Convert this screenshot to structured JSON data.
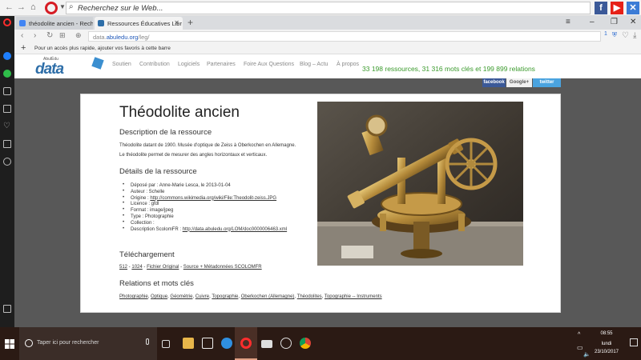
{
  "browser": {
    "search_placeholder": "Recherchez sur le Web...",
    "tabs": [
      {
        "label": "théodolite ancien - Rechr",
        "icon": "google-icon"
      },
      {
        "label": "Ressources Éducatives Libr",
        "icon": "data-abuledu-icon"
      }
    ],
    "url_prefix": "data.",
    "url_domain": "abuledu.org",
    "url_path": "/leg/",
    "badge_count": "1",
    "bookmark_hint": "Pour un accès plus rapide, ajouter vos favoris à cette barre"
  },
  "site": {
    "logo_text": "data",
    "logo_small": "AbulÉdu",
    "menu": [
      "Soutien",
      "Contribution",
      "Logiciels",
      "Partenaires",
      "Foire Aux Questions",
      "Blog – Actu",
      "À propos"
    ],
    "stats": "33 198 ressources, 31 316 mots clés et 199 899 relations",
    "social": [
      "facebook",
      "Google+",
      "twitter"
    ]
  },
  "resource": {
    "title": "Théodolite ancien",
    "desc_heading": "Description de la ressource",
    "desc_line1": "Théodolite datant de 1900. Musée d'optique de Zeiss à Oberkochen en Allemagne.",
    "desc_line2": "Le théodolite permet de mesurer des angles horizontaux et verticaux.",
    "details_heading": "Détails de la ressource",
    "details": {
      "depose": "Déposé par : Anne-Marie Lesca, le 2013-01-04",
      "auteur": "Auteur : Schelle",
      "origine_label": "Origine : ",
      "origine_link": "http://commons.wikimedia.org/wiki/File:Theodolit-zeiss.JPG",
      "licence": "Licence : gfdl",
      "format": "Format : image/jpeg",
      "type": "Type : Photographie",
      "collection": "Collection :",
      "scolom_label": "Description ScolomFR : ",
      "scolom_link": "http://data.abuledu.org/LOM/doc0000006463.xml"
    },
    "download_heading": "Téléchargement",
    "downloads": [
      "512",
      "1024",
      "Fichier Original",
      "Source + Métadonnées SCOLOMFR"
    ],
    "relations_heading": "Relations et mots clés",
    "keywords": [
      "Photographie",
      "Optique",
      "Géométrie",
      "Cuivre",
      "Topographie",
      "Oberkochen (Allemagne)",
      "Théodolites",
      "Topographie -- Instruments"
    ]
  },
  "taskbar": {
    "search_placeholder": "Taper ici pour rechercher",
    "time": "08:55",
    "day": "lundi",
    "date": "23/10/2017"
  },
  "colors": {
    "stats_green": "#3a9a2c",
    "opera_red": "#d61c24",
    "link_blue": "#1d56b8"
  }
}
